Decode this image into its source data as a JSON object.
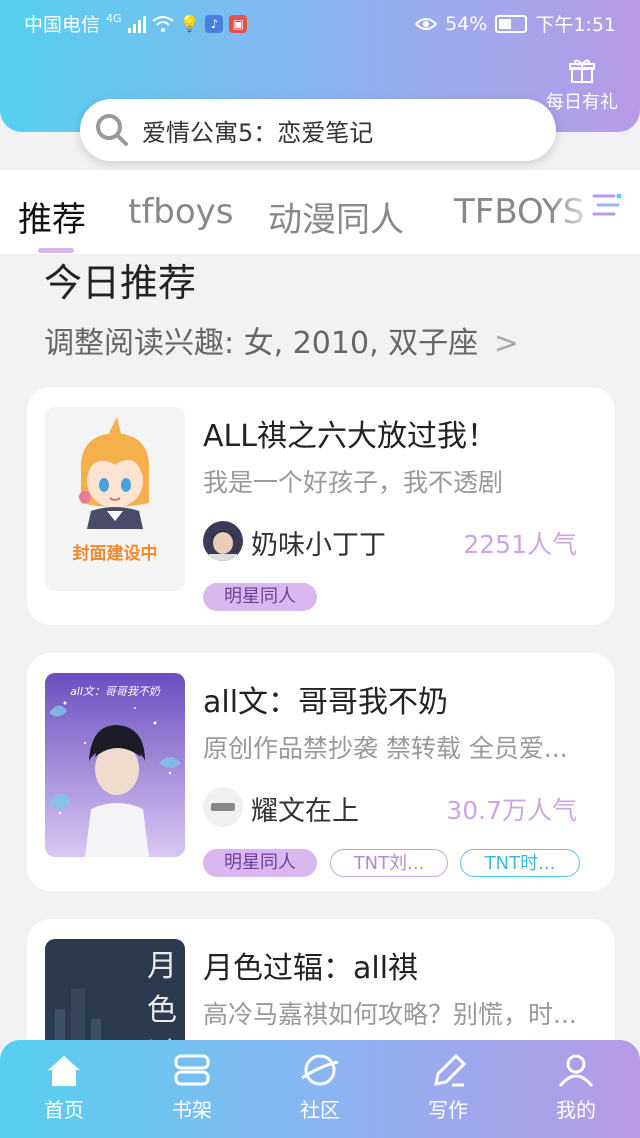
{
  "status_bar": {
    "carrier": "中国电信",
    "network": "4G",
    "battery": "54%",
    "time": "下午1:51"
  },
  "header": {
    "gift_label": "每日有礼",
    "gift_icon": "gift-icon"
  },
  "search": {
    "placeholder": "爱情公寓5：恋爱笔记",
    "icon": "search-icon"
  },
  "tabs": [
    {
      "label": "推荐",
      "active": true
    },
    {
      "label": "tfboys",
      "active": false
    },
    {
      "label": "动漫同人",
      "active": false
    },
    {
      "label": "TFBOYS",
      "active": false
    }
  ],
  "section": {
    "title": "今日推荐",
    "subtitle": "调整阅读兴趣: 女, 2010, 双子座"
  },
  "books": [
    {
      "title": "ALL祺之六大放过我！",
      "desc": "我是一个好孩子，我不透剧",
      "author": "奶味小丁丁",
      "popularity": "2251人气",
      "cover_text": "封面建设中",
      "tags": [
        "明星同人"
      ]
    },
    {
      "title": "all文：哥哥我不奶",
      "desc": "原创作品禁抄袭 禁转载 全员爱...",
      "author": "耀文在上",
      "popularity": "30.7万人气",
      "cover_text": "all文：哥哥我不奶",
      "tags": [
        "明星同人",
        "TNT刘...",
        "TNT时..."
      ]
    },
    {
      "title": "月色过辐：all祺",
      "desc": "高冷马嘉祺如何攻略？别慌，时...",
      "cover_text": "月色过",
      "tags": []
    }
  ],
  "bottom_nav": [
    {
      "label": "首页",
      "icon": "home-icon",
      "active": true
    },
    {
      "label": "书架",
      "icon": "bookshelf-icon",
      "active": false
    },
    {
      "label": "社区",
      "icon": "planet-icon",
      "active": false
    },
    {
      "label": "写作",
      "icon": "pen-icon",
      "active": false
    },
    {
      "label": "我的",
      "icon": "user-icon",
      "active": false
    }
  ],
  "colors": {
    "gradient_start": "#56d0f0",
    "gradient_end": "#b79ae6",
    "tag_purple": "#d9b7ef",
    "popularity": "#cba6e4",
    "tag_cyan": "#55c9ec"
  }
}
